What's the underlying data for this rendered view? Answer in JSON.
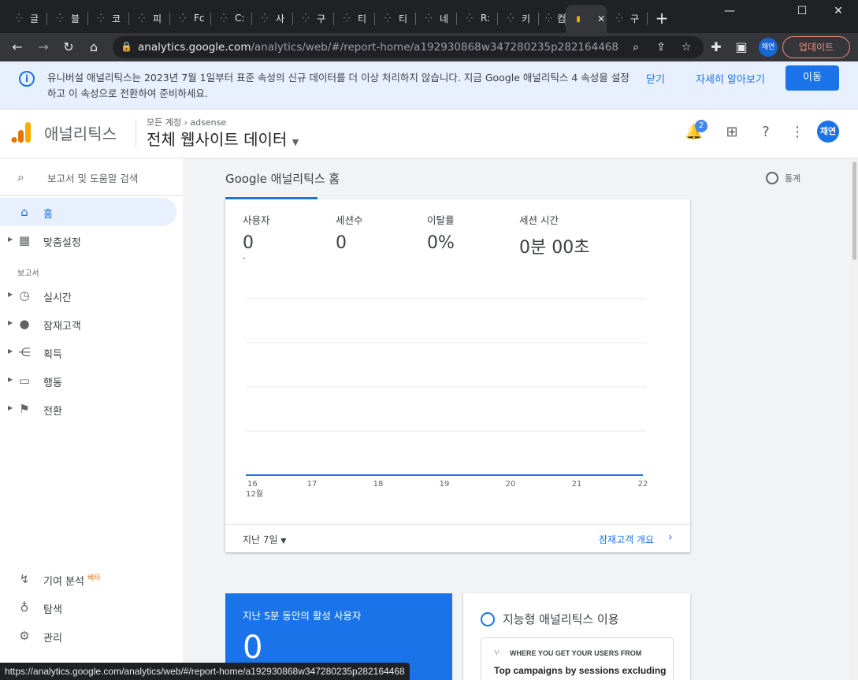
{
  "browser": {
    "tabs": [
      {
        "label": "글",
        "left": 0
      },
      {
        "label": "블",
        "left": 0
      },
      {
        "label": "코",
        "left": 0
      },
      {
        "label": "피",
        "left": 0
      },
      {
        "label": "Fc",
        "left": 0
      },
      {
        "label": "C:",
        "left": 0
      },
      {
        "label": "사",
        "left": 0
      },
      {
        "label": "구",
        "left": 0
      },
      {
        "label": "티",
        "left": 0
      },
      {
        "label": "티",
        "left": 0
      },
      {
        "label": "네",
        "left": 0
      },
      {
        "label": "R:",
        "left": 0
      },
      {
        "label": "키",
        "left": 0
      },
      {
        "label": "컴",
        "left": 0
      },
      {
        "label": "",
        "left": 0
      },
      {
        "label": "구",
        "left": 0
      }
    ],
    "url_host": "analytics.google.com",
    "url_path": "/analytics/web/#/report-home/a192930868w347280235p282164468",
    "profile_label": "채연",
    "update_label": "업데이트",
    "status_url": "https://analytics.google.com/analytics/web/#/report-home/a192930868w347280235p282164468"
  },
  "banner": {
    "message": "유니버설 애널리틱스는 2023년 7월 1일부터 표준 속성의 신규 데이터를 더 이상 처리하지 않습니다. 지금 Google 애널리틱스 4 속성을 설정하고 이 속성으로 전환하여 준비하세요.",
    "close": "닫기",
    "learn_more": "자세히 알아보기",
    "go": "이동"
  },
  "header": {
    "app_name": "애널리틱스",
    "crumb_account": "모든 계정",
    "crumb_property": "adsense",
    "property_view": "전체 웹사이트 데이터",
    "notification_count": "2",
    "avatar": "채연"
  },
  "sidebar": {
    "search": "보고서 및 도움말 검색",
    "home": "홈",
    "customization": "맞춤설정",
    "reports_section": "보고서",
    "realtime": "실시간",
    "audience": "잠재고객",
    "acquisition": "획득",
    "behavior": "행동",
    "conversions": "전환",
    "attribution": "기여 분석",
    "beta": "베타",
    "discover": "탐색",
    "admin": "관리"
  },
  "main": {
    "title": "Google 애널리틱스 홈",
    "stats_link": "통계",
    "metrics": [
      {
        "name": "사용자",
        "value": "0",
        "delta": "-"
      },
      {
        "name": "세션수",
        "value": "0",
        "delta": ""
      },
      {
        "name": "이탈률",
        "value": "0%",
        "delta": ""
      },
      {
        "name": "세션 시간",
        "value": "0분 00초",
        "delta": ""
      }
    ],
    "date_range": "지난 7일",
    "audience_overview": "잠재고객 개요",
    "realtime_title": "지난 5분 동안의 활성 사용자",
    "realtime_value": "0",
    "insights_title": "지능형 애널리틱스 이용",
    "insights_heading": "WHERE YOU GET YOUR USERS FROM",
    "insights_body": "Top campaigns by sessions excluding"
  },
  "chart_data": {
    "type": "line",
    "categories": [
      "16",
      "17",
      "18",
      "19",
      "20",
      "21",
      "22"
    ],
    "month_label": "12월",
    "series": [
      {
        "values": [
          0,
          0,
          0,
          0,
          0,
          0,
          0
        ]
      }
    ],
    "color": "#1a73e8",
    "grid": true
  }
}
